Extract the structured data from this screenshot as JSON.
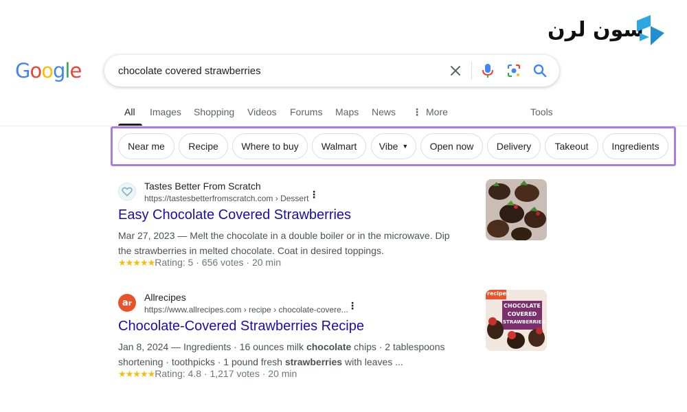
{
  "watermark": {
    "text": "سون لرن"
  },
  "search": {
    "query": "chocolate covered strawberries"
  },
  "tabs": [
    {
      "label": "All"
    },
    {
      "label": "Images"
    },
    {
      "label": "Shopping"
    },
    {
      "label": "Videos"
    },
    {
      "label": "Forums"
    },
    {
      "label": "Maps"
    },
    {
      "label": "News"
    },
    {
      "label": "More"
    },
    {
      "label": "Tools"
    }
  ],
  "chips": [
    {
      "label": "Near me"
    },
    {
      "label": "Recipe"
    },
    {
      "label": "Where to buy"
    },
    {
      "label": "Walmart"
    },
    {
      "label": "Vibe"
    },
    {
      "label": "Open now"
    },
    {
      "label": "Delivery"
    },
    {
      "label": "Takeout"
    },
    {
      "label": "Ingredients"
    }
  ],
  "results": [
    {
      "site_name": "Tastes Better From Scratch",
      "url": "https://tastesbetterfromscratch.com › Dessert",
      "title": "Easy Chocolate Covered Strawberries",
      "snippet_date": "Mar 27, 2023",
      "snippet_text": "Melt the chocolate in a double boiler or in the microwave. Dip the strawberries in melted chocolate. Coat in desired toppings.",
      "rating": "Rating: 5",
      "votes": "656 votes",
      "time": "20 min"
    },
    {
      "site_name": "Allrecipes",
      "url": "https://www.allrecipes.com › recipe › chocolate-covere...",
      "title": "Chocolate-Covered Strawberries Recipe",
      "snippet_date": "Jan 8, 2024",
      "snippet_parts": [
        "Ingredients · 16 ounces milk ",
        "chocolate",
        " chips · 2 tablespoons shortening · toothpicks · 1 pound fresh ",
        "strawberries",
        " with leaves ..."
      ],
      "rating": "Rating: 4.8",
      "votes": "1,217 votes",
      "time": "20 min",
      "thumb_text": [
        "recipes",
        "CHOCOLATE",
        "COVERED",
        "STRAWBERRIES"
      ]
    }
  ],
  "colors": {
    "link": "#1a0dab",
    "highlight_frame": "#a97ce6",
    "stars": "#fbbc04"
  }
}
